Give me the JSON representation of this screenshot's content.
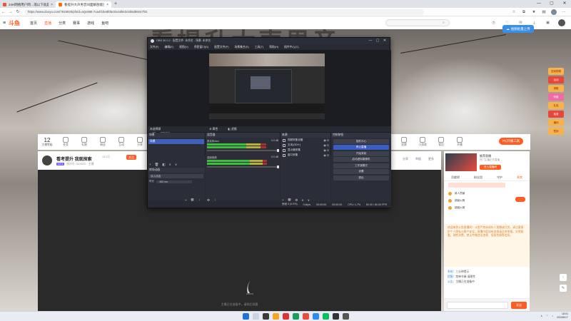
{
  "browser": {
    "tabs": [
      {
        "title": "24H网络用户网…或以下就是游戏出",
        "active": false
      },
      {
        "title": "看提升大声男音间面解剖能否…",
        "active": true
      }
    ],
    "new_tab": "+",
    "url": "https://www.douyu.com/7819020/pfoId=aQx9t6t-7ua4f1be8f0bc914af563c6b5d86047f31",
    "window_controls": {
      "min": "—",
      "max": "▢",
      "close": "✕"
    }
  },
  "douyu": {
    "logo": "斗鱼",
    "nav": [
      {
        "label": "首页",
        "active": false
      },
      {
        "label": "直播",
        "active": true
      },
      {
        "label": "分类",
        "active": false
      },
      {
        "label": "赛事",
        "active": false
      },
      {
        "label": "游戏",
        "active": false
      },
      {
        "label": "鱼吧",
        "active": false
      }
    ],
    "upload_button": "视频批量上传"
  },
  "banner_text": "看提升大声男音",
  "ads": [
    {
      "label": "狂欢购物",
      "style": "gold"
    },
    {
      "label": "活动",
      "style": "red"
    },
    {
      "label": "领取",
      "style": "gold"
    },
    {
      "label": "特惠",
      "style": "pink"
    },
    {
      "label": "礼包",
      "style": "gold"
    },
    {
      "label": "抽奖",
      "style": "red"
    },
    {
      "label": "福利",
      "style": "gold"
    },
    {
      "label": "签到",
      "style": "gold"
    }
  ],
  "room_bar": {
    "level": "12",
    "level_label": "主播等级",
    "items": [
      "任务",
      "礼物",
      "粉丝",
      "互动",
      "分享",
      "语音",
      "设置"
    ],
    "right_items": [
      "投票",
      "小游戏",
      "背包",
      "开播"
    ],
    "pc_button": "PC开播工具"
  },
  "anchor": {
    "name": "看考提升 我就探索",
    "tag": "13.0万",
    "follow": "关注",
    "lv": "LV.1",
    "sub": "房间号 7819020 · 主播",
    "right": [
      "分享",
      "举报",
      "更多"
    ]
  },
  "player": {
    "message": "主播正在准备中，请稍后观看"
  },
  "recommend": {
    "title": "推荐直播",
    "sub": "热门主播正在直播",
    "button": "进入直播间"
  },
  "chat_tabs": [
    "贡献榜",
    "粉丝团",
    "守护",
    "贵宾"
  ],
  "chat_gifts": [
    "新人贡献",
    "超级火箭",
    "超级火箭"
  ],
  "chat_notice": "欢迎来到斗鱼直播间！斗鱼严禁未成年人直播或打赏，请注意保护个人隐私与财产安全。直播内容如有违规请及时举报。文明观看，理性消费，禁止传播违法违规、低俗色情等信息。",
  "chat_messages": [
    {
      "user": "系统",
      "text": "三分钟提示"
    },
    {
      "user": "提醒",
      "text": "禁带节奏 请理性"
    },
    {
      "user": "公告",
      "text": "主播正在准备中"
    }
  ],
  "chat_send": "发送",
  "obs": {
    "title": "OBS 30.0.2 - 配置文件: 未命名 - 场景: 未命名",
    "menu": [
      "文件(F)",
      "编辑(E)",
      "视图(V)",
      "停靠窗口(D)",
      "配置文件(P)",
      "场景集合(S)",
      "工具(T)",
      "帮助(H)",
      "插件中心(C)"
    ],
    "scene_line": [
      "- 0%",
      "场景选择"
    ],
    "mode_left": "未选择源",
    "mode_mid": [
      "属性",
      "滤镜"
    ],
    "docks": {
      "scenes": {
        "title": "场景",
        "selected": "场景"
      },
      "transition": {
        "title": "转场动画",
        "type": "淡入淡出",
        "duration_label": "时长",
        "duration": "300 ms"
      },
      "mixer": {
        "title": "混音器",
        "channels": [
          {
            "name": "麦克风/Aux",
            "db": "0.0 dB",
            "green": 55,
            "yellow": 20,
            "red": 8
          },
          {
            "name": "桌面音频",
            "db": "0.0 dB",
            "green": 60,
            "yellow": 18,
            "red": 6
          }
        ]
      },
      "sources": {
        "title": "来源",
        "items": [
          "视频采集设备",
          "文本(GDI+)",
          "显示器采集",
          "窗口采集"
        ]
      },
      "controls": {
        "title": "控制按钮",
        "buttons": [
          {
            "label": "插件中心",
            "active": false
          },
          {
            "label": "停止直播",
            "active": true
          },
          {
            "label": "开始录制",
            "active": false
          },
          {
            "label": "启动虚拟摄像机",
            "active": false
          },
          {
            "label": "工作室模式",
            "active": false
          },
          {
            "label": "设置",
            "active": false
          },
          {
            "label": "退出",
            "active": false
          }
        ]
      }
    },
    "status": {
      "dropped": "丢帧 0 (0.0%)",
      "bitrate": "0 kbps",
      "live_time": "00:00:00",
      "rec_time": "00:00:00",
      "cpu": "CPU: 1.7%",
      "fps": "60.00 / 60.00 FPS"
    }
  },
  "taskbar": {
    "time": "18:01",
    "date": "2024/6/17"
  }
}
